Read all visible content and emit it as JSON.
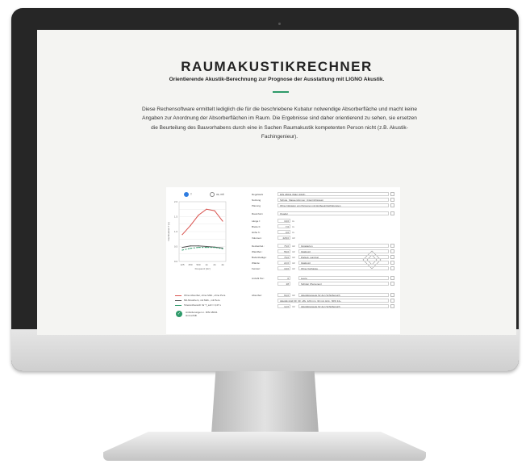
{
  "page": {
    "title": "RAUMAKUSTIKRECHNER",
    "subtitle": "Orientierende Akustik-Berechnung zur Prognose der Ausstattung mit LIGNO Akustik.",
    "intro": "Diese Rechensoftware ermittelt lediglich die für die beschriebene Kubatur notwendige Absorberfläche und macht keine Angaben zur Anordnung der Absorberflächen im Raum. Die Ergebnisse sind daher orientierend zu sehen, sie ersetzen die Beurteilung des Bauvorhabens durch eine in Sachen Raumakustik kompetenten Person nicht (z.B. Akustik-Fachingenieur)."
  },
  "colors": {
    "accent": "#2e9a6a",
    "red_curve": "#d9534f",
    "grey_curve": "#555555",
    "radio_selected": "#2f7de1"
  },
  "calculator": {
    "radios": [
      {
        "label": "T",
        "selected": true
      },
      {
        "label": "αs, mit",
        "selected": false
      }
    ],
    "legend": [
      {
        "label": "Ohne Absorber, ohne Möb., ohne Pers.",
        "color": "#d9534f"
      },
      {
        "label": "Mit Absorbern, mit Möb., mit Pers.",
        "color": "#555555"
      },
      {
        "label": "Toleranzbereich für T_soll = 0,47 s",
        "color": "#2e9a6a"
      }
    ],
    "status": "Anforderungen n. DIN 18041 sind erfüllt",
    "fields": [
      {
        "label": "Regelwerk",
        "value": "DIN 18041 (März 2016)"
      },
      {
        "label": "Nutzung",
        "value": "Schule, Klassenzimmer, Unterrichtsraum"
      },
      {
        "label": "Planung",
        "value": "Ohne Inklusion von Personen mit Hörbeeinträchtigungen"
      },
      {
        "label": "Raumform",
        "value": "Quader"
      },
      {
        "label": "Länge l:",
        "num": "10,0",
        "unit": "m"
      },
      {
        "label": "Breite b:",
        "num": "7,6",
        "unit": "m"
      },
      {
        "label": "Höhe h:",
        "num": "3,0",
        "unit": "m"
      },
      {
        "label": "Volumen:",
        "num": "228,0",
        "unit": "m³"
      },
      {
        "label": "Deckenbel.:",
        "num": "76,0",
        "unit": "m²",
        "value": "Gipskarton"
      },
      {
        "label": "Wandbel.:",
        "num": "56,0",
        "unit": "m²",
        "value": "Glattputz"
      },
      {
        "label": "Bodenbeläge:",
        "num": "76,0",
        "unit": "m²",
        "value": "Parkett, Laminat"
      },
      {
        "label": "Wände:",
        "num": "22,0",
        "unit": "m²",
        "value": "Glattputz"
      },
      {
        "label": "Fenster:",
        "num": "10,0",
        "unit": "m²",
        "value": "Ohne Vorhänge"
      },
      {
        "label": "Anzahl Per.:",
        "num": "0",
        "value": "Leere"
      },
      {
        "label": "",
        "num": "28",
        "value": "Schüler (Personen)"
      },
      {
        "label": "Absorber:",
        "num": "64,0",
        "unit": "m²",
        "value": "Akustikpaneele für den Schulbereich"
      },
      {
        "label": "",
        "value": "Akustik-Grid 30_30_offs, 120 mm, 32 mm Hint., 60% 12+"
      },
      {
        "label": "",
        "num": "12,0",
        "unit": "m²",
        "value": "Akustikpaneele für den Schulbereich"
      }
    ]
  },
  "chart_data": {
    "type": "line",
    "x": [
      "125",
      "250",
      "500",
      "1k",
      "2k",
      "4k"
    ],
    "xlabel": "Frequenz [Hz]",
    "ylabel": "Nachhallzeit T [s]",
    "ylim": [
      0,
      2.0
    ],
    "series": [
      {
        "name": "Ohne Absorber, ohne Möb., ohne Pers.",
        "values": [
          0.9,
          1.2,
          1.55,
          1.75,
          1.7,
          1.35
        ]
      },
      {
        "name": "Mit Absorbern, mit Möb., mit Pers.",
        "values": [
          0.47,
          0.52,
          0.52,
          0.5,
          0.48,
          0.45
        ]
      },
      {
        "name": "Toleranzbereich für T_soll = 0,47 s",
        "values": [
          0.38,
          0.44,
          0.47,
          0.47,
          0.47,
          0.43
        ]
      }
    ]
  }
}
